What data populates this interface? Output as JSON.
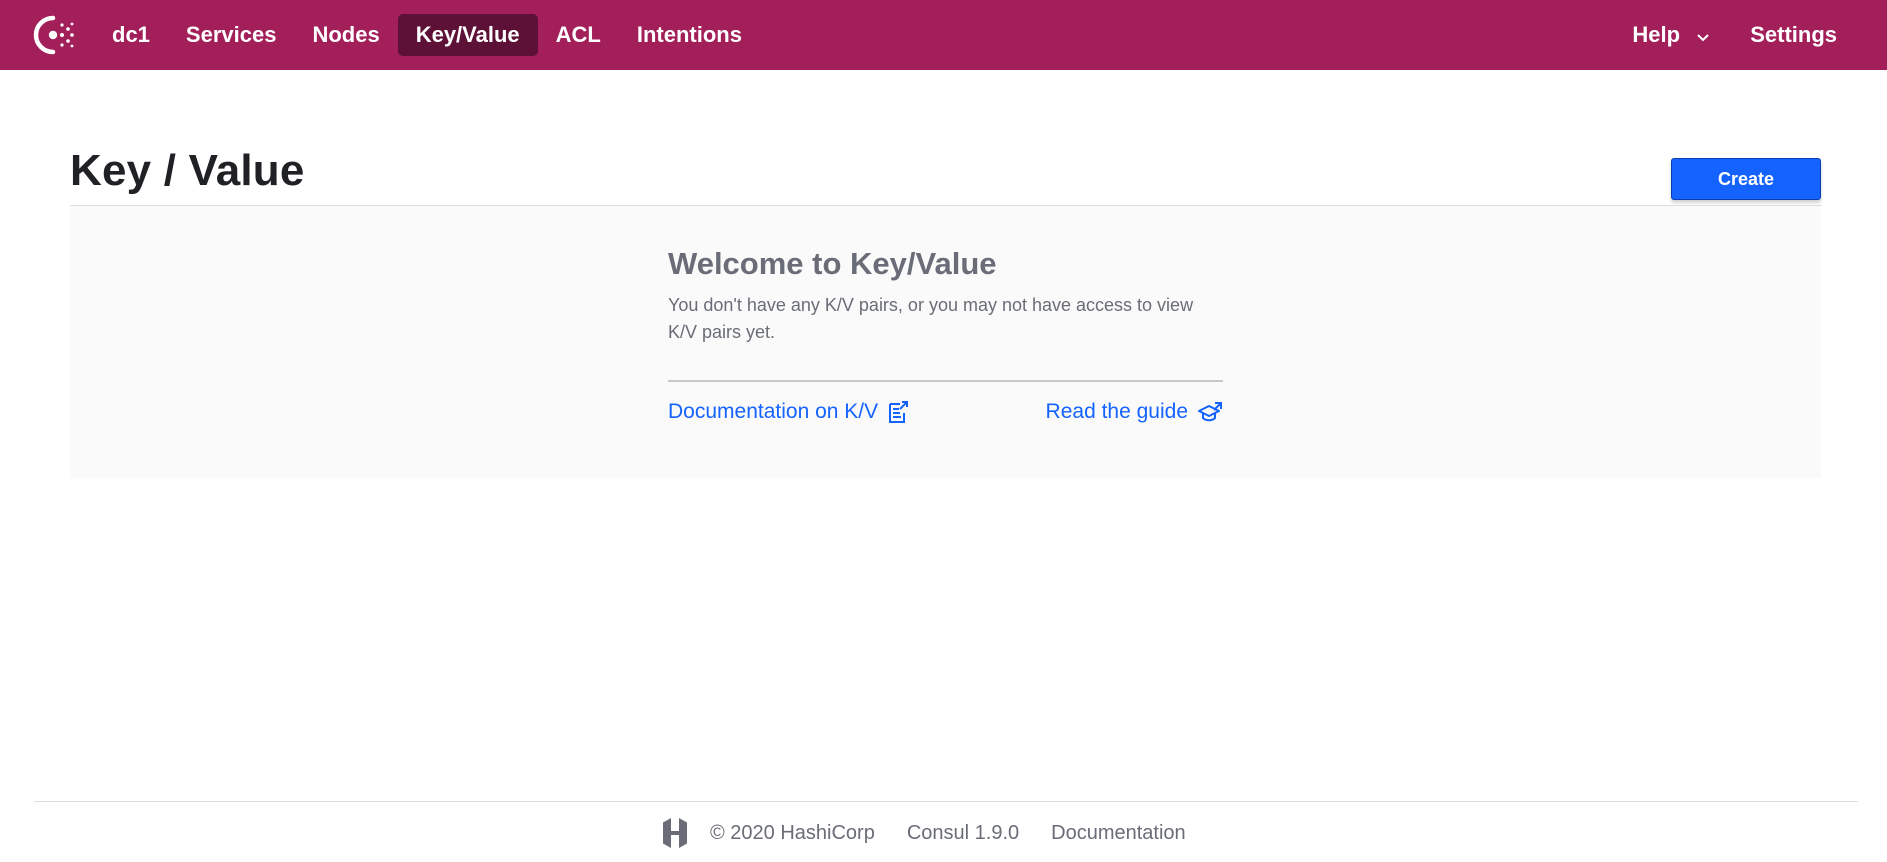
{
  "nav": {
    "logo_icon": "consul-logo-icon",
    "items": [
      {
        "label": "dc1"
      },
      {
        "label": "Services"
      },
      {
        "label": "Nodes"
      },
      {
        "label": "Key/Value",
        "active": true
      },
      {
        "label": "ACL"
      },
      {
        "label": "Intentions"
      }
    ],
    "help_label": "Help",
    "settings_label": "Settings"
  },
  "header": {
    "title": "Key / Value",
    "create_label": "Create"
  },
  "empty_state": {
    "title": "Welcome to Key/Value",
    "body": "You don't have any K/V pairs, or you may not have access to view K/V pairs yet.",
    "doc_link": "Documentation on K/V",
    "guide_link": "Read the guide"
  },
  "footer": {
    "copyright": "© 2020 HashiCorp",
    "version": "Consul 1.9.0",
    "docs_link": "Documentation"
  },
  "colors": {
    "brand": "#a21f5a",
    "nav_active": "#5e1136",
    "primary": "#1563ff",
    "muted_text": "#6a6d77"
  }
}
